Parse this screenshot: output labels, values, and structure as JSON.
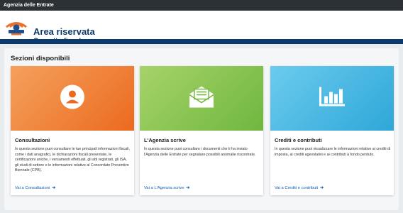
{
  "topbar": {
    "label": "Agenzia delle Entrate"
  },
  "header": {
    "title": "Area riservata",
    "subtitle": "Cassetto fiscale"
  },
  "main": {
    "section_title": "Sezioni disponibili",
    "cards": [
      {
        "title": "Consultazioni",
        "text": "In questa sezione puoi consultare le tue principali informazioni fiscali, come i dati anagrafici, le dichiarazioni fiscali presentate, le certificazioni uniche, i versamenti effettuati, gli atti registrati, gli ISA, gli studi di settore e le informazioni relative al Concordato Preventivo Biennale (CPB).",
        "link": "Vai a Consultazioni",
        "icon": "user-icon",
        "color_from": "#f4a15d",
        "color_to": "#ec6a1f"
      },
      {
        "title": "L'Agenzia scrive",
        "text": "In questa sezione puoi consultare i documenti che ti ha inviato l'Agenzia delle Entrate per segnalare possibili anomalie riscontrate.",
        "link": "Vai a L'Agenzia scrive",
        "icon": "open-mail-icon",
        "color_from": "#a7d36a",
        "color_to": "#6fb73f"
      },
      {
        "title": "Crediti e contributi",
        "text": "In questa sezione puoi visualizzare le informazioni relative ai crediti di imposta, ai crediti agevolativi e ai contributi a fondo perduto.",
        "link": "Vai a Crediti e contributi",
        "icon": "bar-chart-icon",
        "color_from": "#6ccbee",
        "color_to": "#2ea7d8"
      }
    ]
  },
  "colors": {
    "brand": "#0b3a6b",
    "link": "#0a5fb4",
    "topbar": "#2c3136"
  }
}
